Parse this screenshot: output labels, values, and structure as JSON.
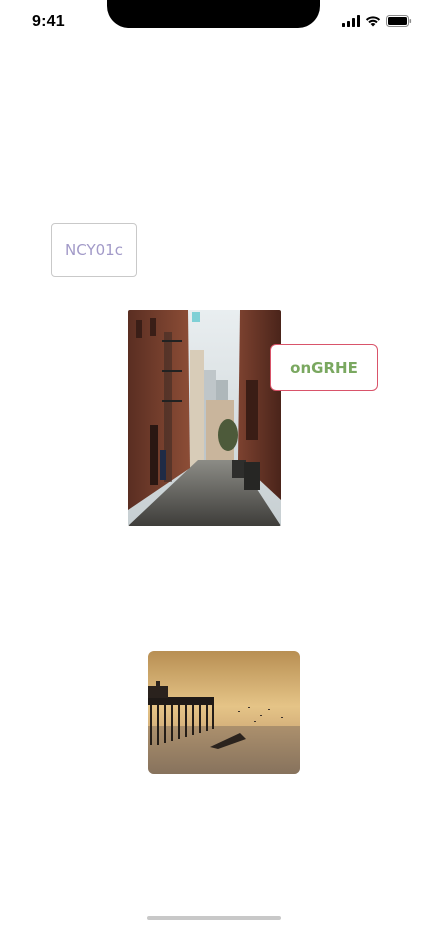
{
  "status_bar": {
    "time": "9:41",
    "icons": [
      "signal-icon",
      "wifi-icon",
      "battery-icon"
    ]
  },
  "buttons": {
    "first_label": "NCY01c",
    "second_label": "onGRHE"
  },
  "colors": {
    "first_button_text": "#a29ac8",
    "second_button_text": "#7aa860",
    "second_button_border": "#d9546a"
  }
}
